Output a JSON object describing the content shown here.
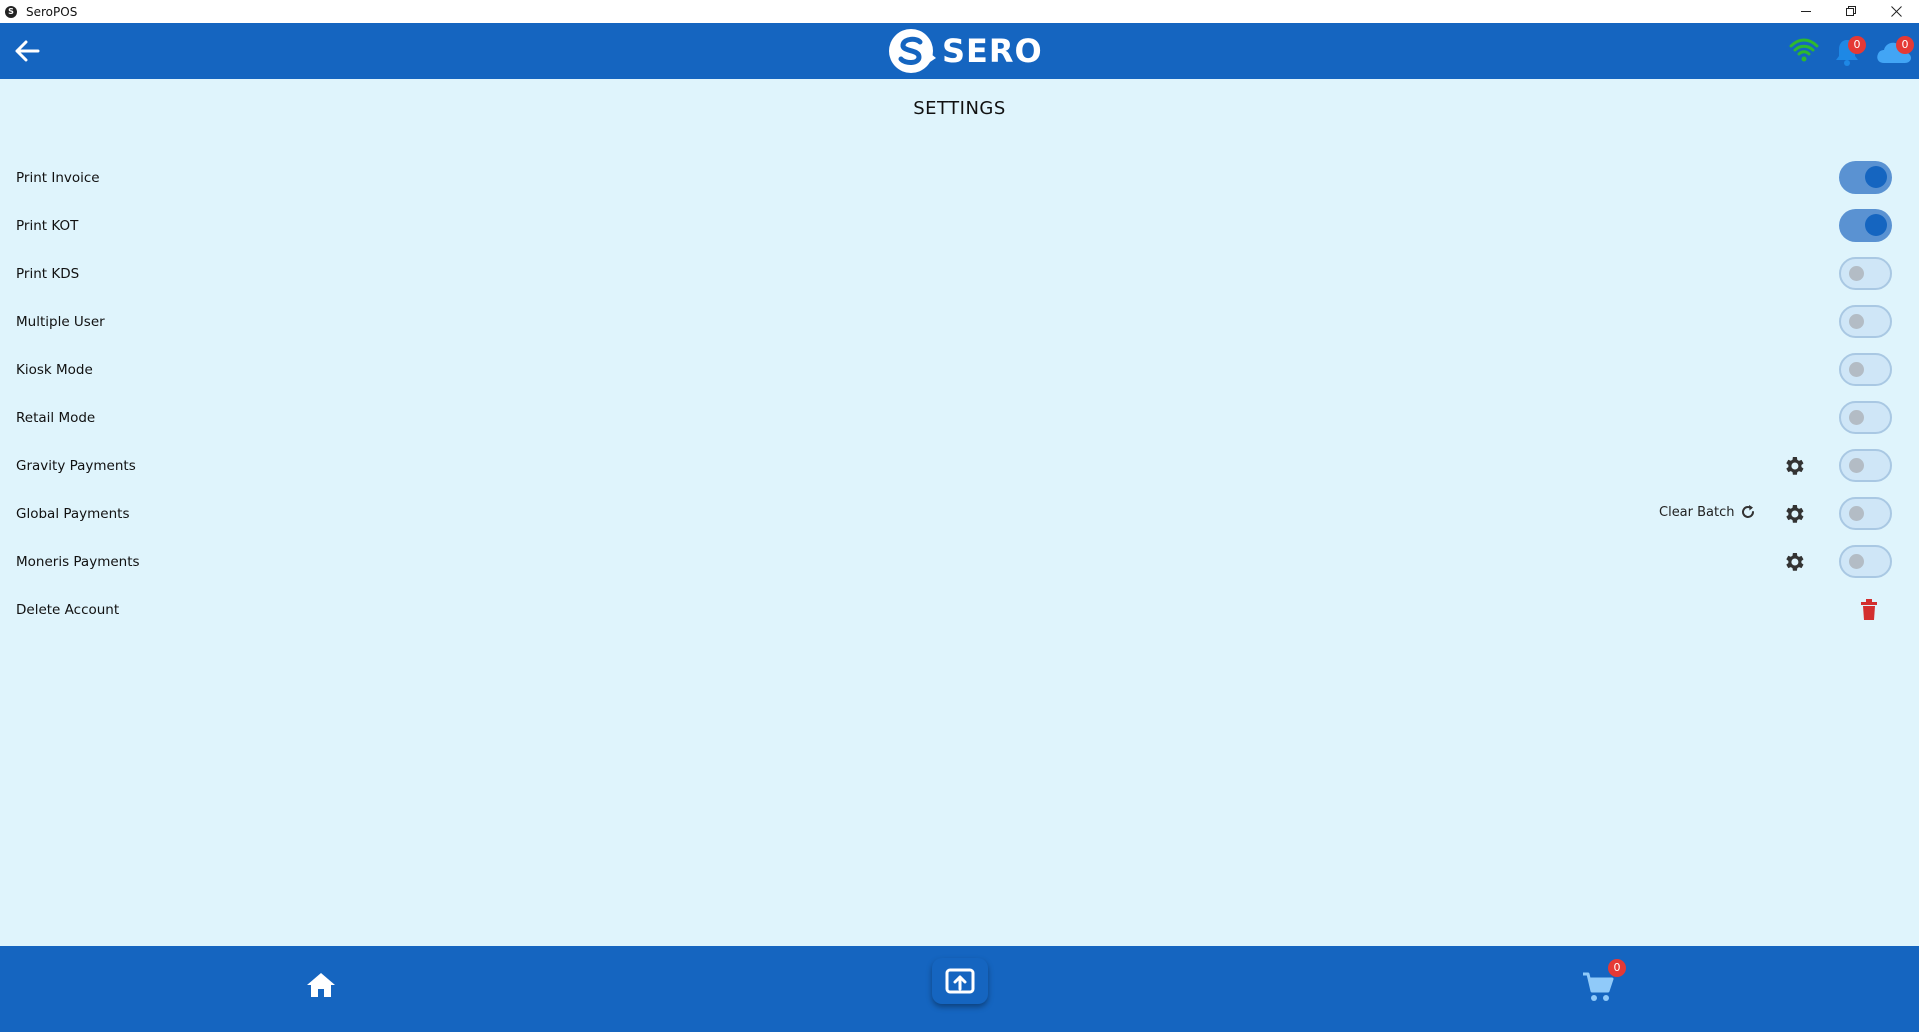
{
  "window": {
    "title": "SeroPOS",
    "app_icon": "S"
  },
  "header": {
    "logo_text": "SERO",
    "notifications_count": "0",
    "cloud_count": "0"
  },
  "page": {
    "title": "SETTINGS"
  },
  "settings": [
    {
      "label": "Print Invoice",
      "type": "toggle",
      "on": true
    },
    {
      "label": "Print KOT",
      "type": "toggle",
      "on": true
    },
    {
      "label": "Print KDS",
      "type": "toggle",
      "on": false
    },
    {
      "label": "Multiple User",
      "type": "toggle",
      "on": false
    },
    {
      "label": "Kiosk Mode",
      "type": "toggle",
      "on": false
    },
    {
      "label": "Retail Mode",
      "type": "toggle",
      "on": false
    },
    {
      "label": "Gravity Payments",
      "type": "toggle",
      "on": false,
      "gear": true
    },
    {
      "label": "Global Payments",
      "type": "toggle",
      "on": false,
      "gear": true,
      "extra": "Clear Batch"
    },
    {
      "label": "Moneris Payments",
      "type": "toggle",
      "on": false,
      "gear": true
    },
    {
      "label": "Delete Account",
      "type": "delete"
    }
  ],
  "bottom_nav": {
    "cart_count": "0"
  },
  "colors": {
    "primary": "#1565c0",
    "background": "#dff4fc",
    "wifi": "#2eb82e",
    "badge": "#e53935",
    "danger": "#d32f2f"
  }
}
